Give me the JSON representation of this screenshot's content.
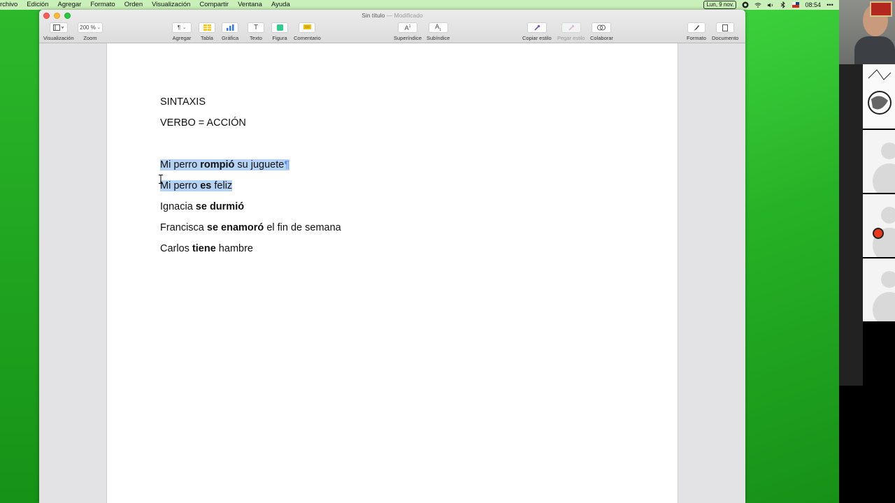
{
  "menubar": {
    "items": [
      "rchivo",
      "Edición",
      "Agregar",
      "Formato",
      "Orden",
      "Visualización",
      "Compartir",
      "Ventana",
      "Ayuda"
    ],
    "date": "Lun, 9 nov.",
    "time": "08:54"
  },
  "window": {
    "title": "Sin título",
    "modified": "— Modificado"
  },
  "toolbar": {
    "view_label": "Visualización",
    "zoom_value": "200 %",
    "zoom_label": "Zoom",
    "insert_label": "Agregar",
    "table_label": "Tabla",
    "chart_label": "Gráfica",
    "text_label": "Texto",
    "shape_label": "Figura",
    "comment_label": "Comentario",
    "superscript_label": "Superíndice",
    "subscript_label": "Subíndice",
    "copy_style_label": "Copiar estilo",
    "paste_style_label": "Pegar estilo",
    "collaborate_label": "Colaborar",
    "format_label": "Formato",
    "document_label": "Documento",
    "colors": {
      "table": "#f5c400",
      "chart": "#2f7ae5",
      "shape": "#2ecc8f",
      "comment": "#f5c400"
    }
  },
  "document": {
    "line1": "SINTAXIS",
    "line2": "VERBO = ACCIÓN",
    "s1": {
      "pre": "Mi perro ",
      "verb": "rompió",
      "post": " su juguete",
      "mark": "¶"
    },
    "s2": {
      "pre": "Mi perro ",
      "verb": "es",
      "post": " feliz"
    },
    "s3": {
      "pre": "Ignacia ",
      "verb": "se durmió",
      "post": ""
    },
    "s4": {
      "pre": "Francisca ",
      "verb": "se enamoró",
      "post": " el fin de semana"
    },
    "s5": {
      "pre": "Carlos ",
      "verb": "tiene",
      "post": " hambre"
    }
  },
  "colors": {
    "selection": "#b5d3f5",
    "desktop": "#2fc42f"
  }
}
